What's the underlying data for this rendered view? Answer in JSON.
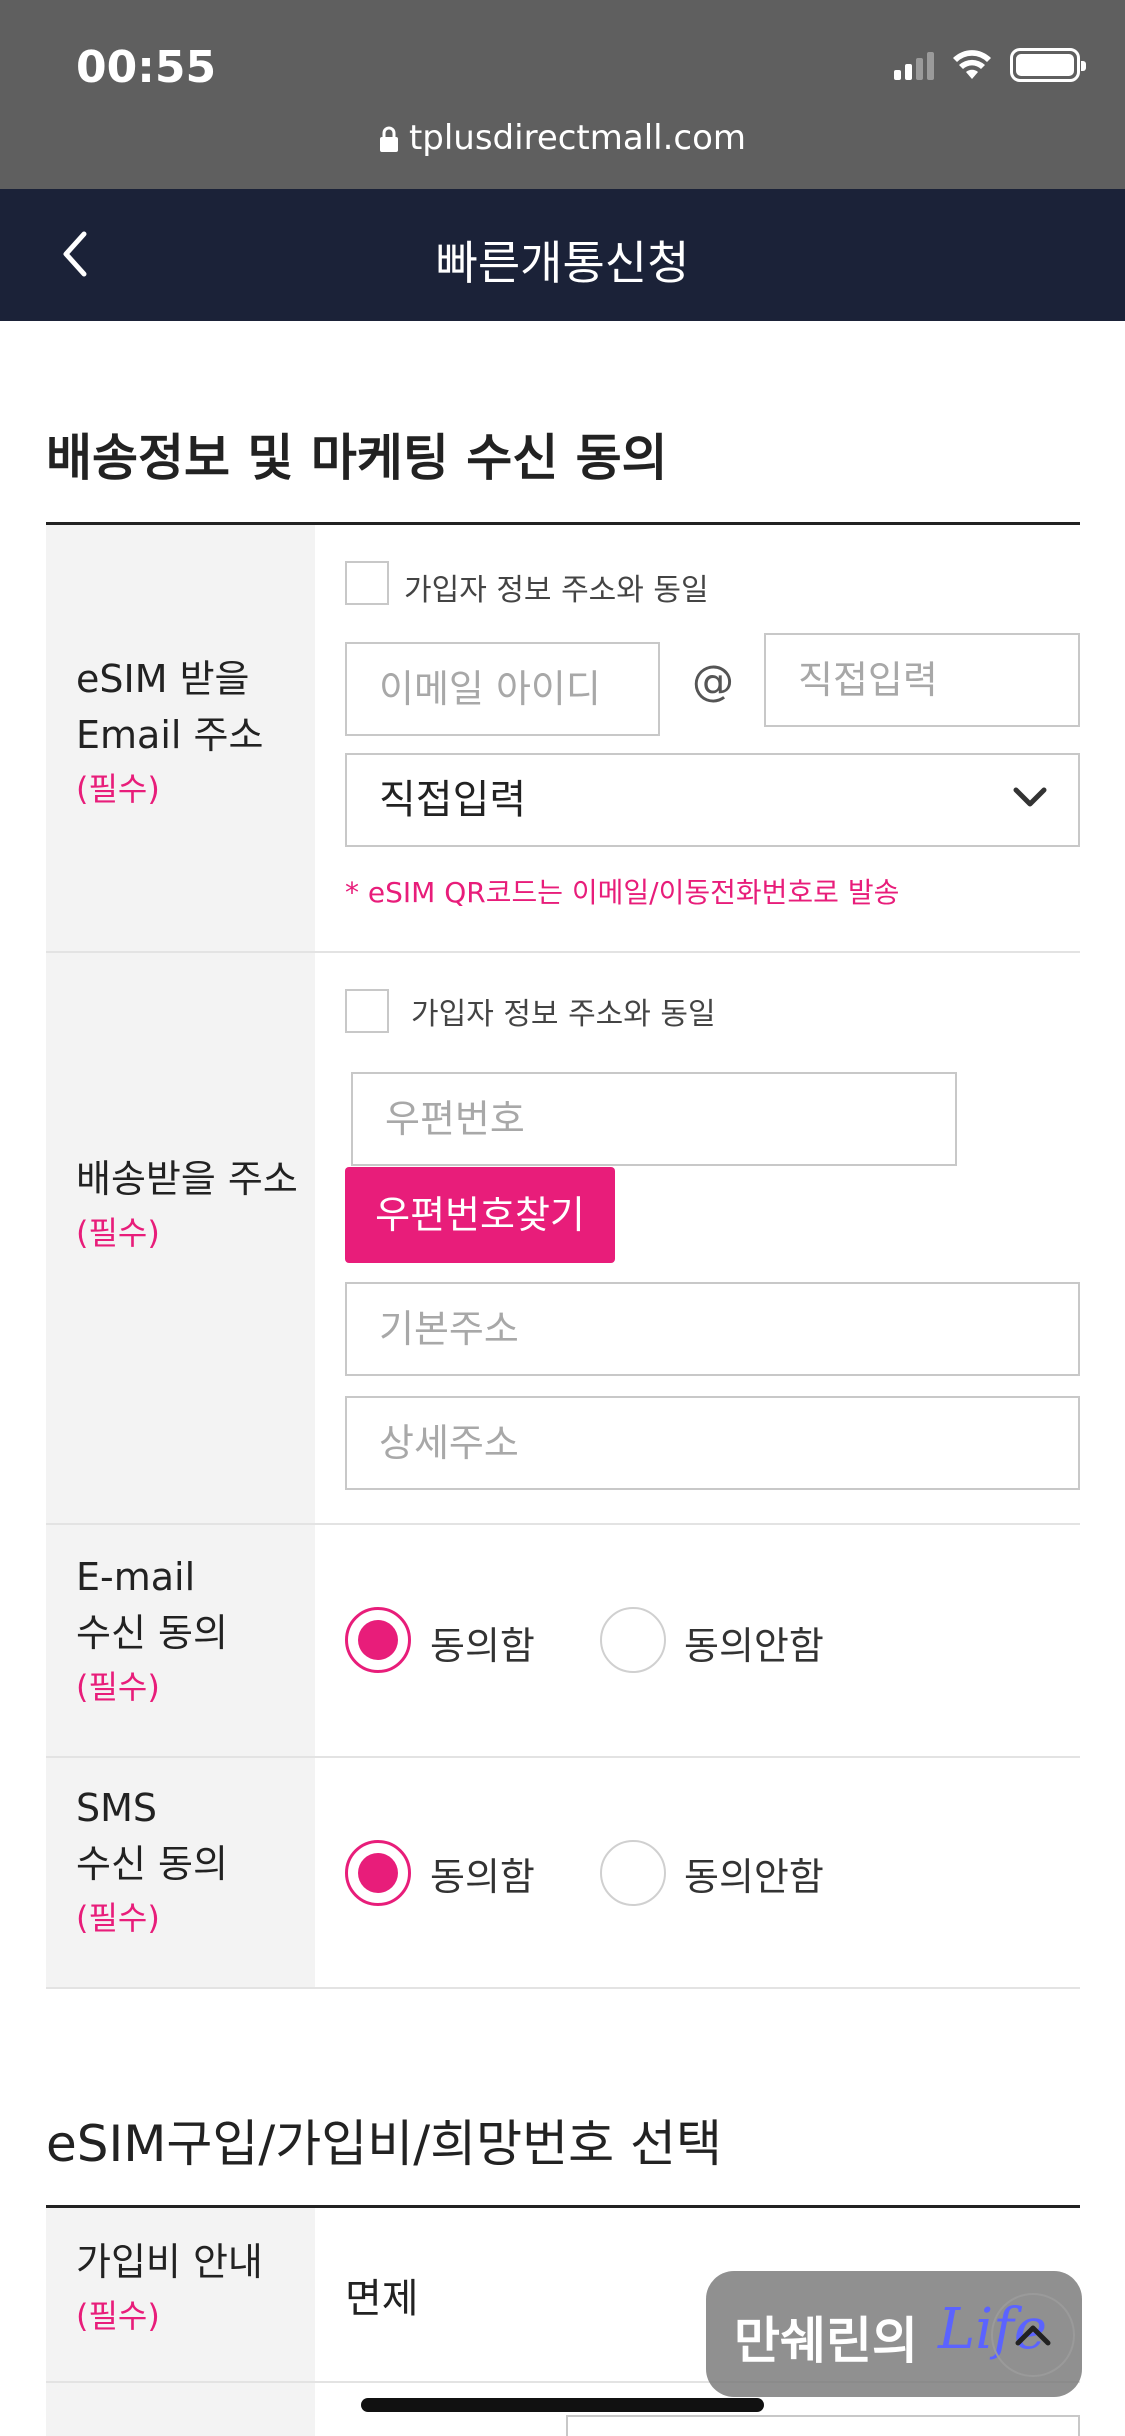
{
  "status_bar": {
    "time": "00:55",
    "url": "tplusdirectmall.com"
  },
  "header": {
    "title": "빠른개통신청"
  },
  "section1": {
    "title": "배송정보 및 마케팅 수신 동의"
  },
  "esim_email": {
    "label_line1": "eSIM 받을",
    "label_line2": "Email 주소",
    "required": "(필수)",
    "same_as_label": "가입자 정보 주소와 동일",
    "id_placeholder": "이메일 아이디",
    "at_symbol": "@",
    "domain_placeholder": "직접입력",
    "domain_select_value": "직접입력",
    "note": "* eSIM QR코드는 이메일/이동전화번호로 발송"
  },
  "shipping_address": {
    "label": "배송받을 주소",
    "required": "(필수)",
    "same_as_label": "가입자 정보 주소와 동일",
    "zip_placeholder": "우편번호",
    "find_zip_button": "우편번호찾기",
    "basic_placeholder": "기본주소",
    "detail_placeholder": "상세주소"
  },
  "email_consent": {
    "label_line1": "E-mail",
    "label_line2": "수신 동의",
    "required": "(필수)",
    "agree": "동의함",
    "disagree": "동의안함",
    "selected": "agree"
  },
  "sms_consent": {
    "label_line1": "SMS",
    "label_line2": "수신 동의",
    "required": "(필수)",
    "agree": "동의함",
    "disagree": "동의안함",
    "selected": "agree"
  },
  "section2": {
    "title": "eSIM구입/가입비/희망번호 선택"
  },
  "join_fee": {
    "label": "가입비 안내",
    "required": "(필수)",
    "value": "면제"
  },
  "watermark": {
    "text": "만쉐린의",
    "life": "Life"
  },
  "colors": {
    "accent": "#e81d7a",
    "header_bg": "#1b2238",
    "browser_bar": "#5f5f5f",
    "label_bg": "#f3f3f3"
  },
  "icons": [
    "lock-icon",
    "back-chevron-icon",
    "chevron-down-icon",
    "chevron-up-icon",
    "signal-icon",
    "wifi-icon",
    "battery-icon"
  ]
}
